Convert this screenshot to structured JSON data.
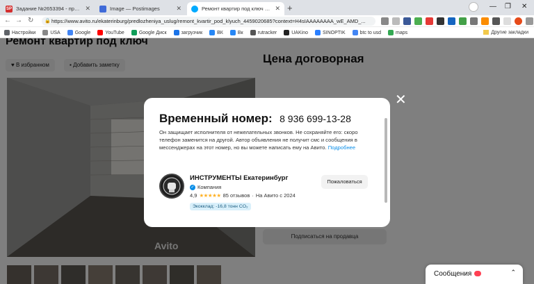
{
  "tabs": [
    {
      "favicon": "SP",
      "favicon_color": "#d32f2f",
      "title": "Задание №2653394 - просмотр з",
      "active": false
    },
    {
      "favicon": "image-icon",
      "favicon_color": "#3f6ad8",
      "title": "Image — Postimages",
      "active": false
    },
    {
      "favicon": "avito-icon",
      "favicon_color": "#00aaff",
      "title": "Ремонт квартир под ключ в Екат",
      "active": true
    }
  ],
  "address_bar": {
    "url": "https://www.avito.ru/ekaterinburg/predlozheniya_uslug/remont_kvartir_pod_klyuch_4459020685?context=H4sIAAAAAAAA_wE_AMD_..."
  },
  "bookmarks": [
    {
      "label": "Настройки",
      "icon": "gear-icon",
      "color": "#5f6368"
    },
    {
      "label": "USA",
      "icon": "bookmark-icon",
      "color": "#888"
    },
    {
      "label": "Google",
      "icon": "google-icon",
      "color": "#4285f4"
    },
    {
      "label": "YouTube",
      "icon": "youtube-icon",
      "color": "#ff0000"
    },
    {
      "label": "Google Диск",
      "icon": "drive-icon",
      "color": "#0f9d58"
    },
    {
      "label": "загрузчик",
      "icon": "download-icon",
      "color": "#1a73e8"
    },
    {
      "label": "ВК",
      "icon": "vk-icon",
      "color": "#2787f5"
    },
    {
      "label": "Вк",
      "icon": "vk-icon",
      "color": "#2787f5"
    },
    {
      "label": "rutracker",
      "icon": "rutracker-icon",
      "color": "#555"
    },
    {
      "label": "UAKino",
      "icon": "uakino-icon",
      "color": "#222"
    },
    {
      "label": "SINOPTIK",
      "icon": "sinoptik-icon",
      "color": "#2a7fff"
    },
    {
      "label": "btc to usd",
      "icon": "google-icon",
      "color": "#4285f4"
    },
    {
      "label": "maps",
      "icon": "maps-icon",
      "color": "#34a853"
    }
  ],
  "other_bookmarks": "Другие закладки",
  "page": {
    "listing_title": "Ремонт квартир под ключ",
    "favorite_label": "В избранном",
    "note_label": "Добавить заметку",
    "price": "Цена договорная",
    "watermark": "Avito",
    "subscribe_label": "Подписаться на продавца",
    "messages_label": "Сообщения",
    "thumbnail_count": 8
  },
  "modal": {
    "title": "Временный номер:",
    "phone": "8 936 699-13-28",
    "description": "Он защищает исполнителя от нежелательных звонков. Не сохраняйте его: скоро телефон заменится на другой. Автор объявления не получит смс и сообщения в мессенджерах на этот номер, но вы можете написать ему на Авито.",
    "more_link": "Подробнее",
    "seller": {
      "name": "ИНСТРУМЕНТЫ Екатеринбург",
      "type": "Компания",
      "rating": "4,9",
      "stars": "★★★★★",
      "reviews": "85 отзывов",
      "since": "На Авито с 2024",
      "eco": "Экокклад: -16,8 тонн CO₂"
    },
    "complain_label": "Пожаловаться"
  },
  "colors": {
    "link": "#0a8ee8",
    "star": "#ffb021",
    "overlay": "rgba(0,0,0,0.5)"
  }
}
